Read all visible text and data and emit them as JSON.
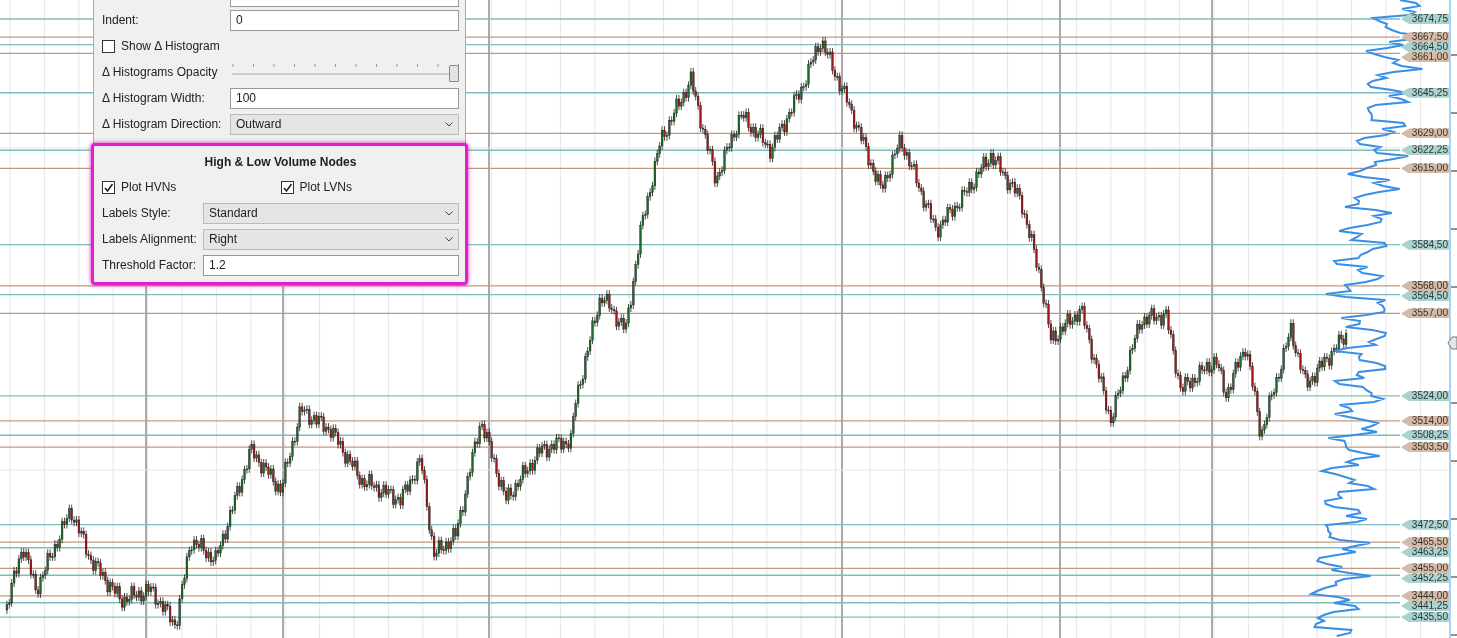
{
  "settings_panel": {
    "fields": [
      {
        "kind": "text",
        "label": "Indent:",
        "value": "0"
      },
      {
        "kind": "checkbox",
        "label": "Show Δ Histogram",
        "checked": false
      },
      {
        "kind": "slider",
        "label": "Δ Histograms Opacity",
        "level": 1
      },
      {
        "kind": "text",
        "label": "Δ Histogram Width:",
        "value": "100"
      },
      {
        "kind": "select",
        "label": "Δ Histogram Direction:",
        "value": "Outward"
      }
    ],
    "section": {
      "title": "High & Low Volume Nodes",
      "highlighted": true,
      "checkboxes": [
        {
          "label": "Plot HVNs",
          "checked": true
        },
        {
          "label": "Plot LVNs",
          "checked": true
        }
      ],
      "fields": [
        {
          "kind": "select",
          "label": "Labels Style:",
          "value": "Standard"
        },
        {
          "kind": "select",
          "label": "Labels Alignment:",
          "value": "Right"
        },
        {
          "kind": "text",
          "label": "Threshold Factor:",
          "value": "1.2"
        }
      ]
    }
  },
  "price_axis": {
    "nodes": [
      {
        "price": "3674,75",
        "kind": "hvn"
      },
      {
        "price": "3667,50",
        "kind": "lvn"
      },
      {
        "price": "3664,50",
        "kind": "hvn"
      },
      {
        "price": "3661,00",
        "kind": "lvn"
      },
      {
        "price": "3645,25",
        "kind": "hvn"
      },
      {
        "price": "3629,00",
        "kind": "lvn"
      },
      {
        "price": "3622,25",
        "kind": "hvn"
      },
      {
        "price": "3615,00",
        "kind": "lvn"
      },
      {
        "price": "3584,50",
        "kind": "hvn"
      },
      {
        "price": "3568,00",
        "kind": "lvn"
      },
      {
        "price": "3564,50",
        "kind": "hvn"
      },
      {
        "price": "3557,00",
        "kind": "lvn"
      },
      {
        "price": "3524,00",
        "kind": "hvn"
      },
      {
        "price": "3514,00",
        "kind": "lvn"
      },
      {
        "price": "3508,25",
        "kind": "hvn"
      },
      {
        "price": "3503,50",
        "kind": "lvn"
      },
      {
        "price": "3472,50",
        "kind": "hvn"
      },
      {
        "price": "3465,50",
        "kind": "lvn"
      },
      {
        "price": "3463,25",
        "kind": "hvn"
      },
      {
        "price": "3455,00",
        "kind": "lvn"
      },
      {
        "price": "3452,25",
        "kind": "hvn"
      },
      {
        "price": "3444,00",
        "kind": "lvn"
      },
      {
        "price": "3441,25",
        "kind": "hvn"
      },
      {
        "price": "3435,50",
        "kind": "hvn"
      }
    ]
  }
}
